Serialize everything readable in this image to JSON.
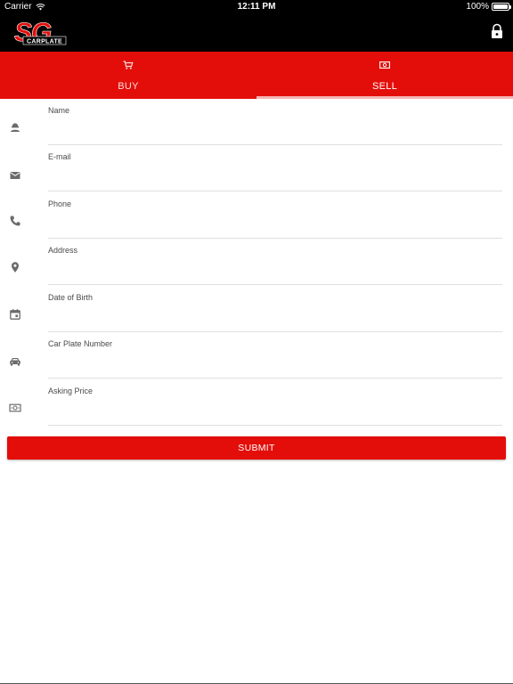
{
  "status_bar": {
    "carrier": "Carrier",
    "time": "12:11 PM",
    "battery": "100%",
    "icons": [
      "wifi-icon",
      "battery-icon"
    ]
  },
  "app_bar": {
    "logo_text_top": "SG",
    "logo_text_bottom": "CARPLATE",
    "icons": [
      "lock-icon"
    ]
  },
  "tabs": [
    {
      "label": "BUY",
      "icon": "cart-icon",
      "selected": false
    },
    {
      "label": "SELL",
      "icon": "money-icon",
      "selected": true
    }
  ],
  "form": {
    "fields": [
      {
        "label": "Name",
        "value": "",
        "icon": "person-icon"
      },
      {
        "label": "E-mail",
        "value": "",
        "icon": "envelope-icon"
      },
      {
        "label": "Phone",
        "value": "",
        "icon": "phone-icon"
      },
      {
        "label": "Address",
        "value": "",
        "icon": "location-pin-icon"
      },
      {
        "label": "Date of Birth",
        "value": "",
        "icon": "calendar-icon"
      },
      {
        "label": "Car Plate Number",
        "value": "",
        "icon": "car-icon"
      },
      {
        "label": "Asking Price",
        "value": "",
        "icon": "money-icon"
      }
    ],
    "submit_label": "SUBMIT"
  },
  "colors": {
    "primary_red": "#e30e0a",
    "app_bar": "#000000",
    "tab_indicator": "#f4b5b3",
    "icon_gray": "#6b6b6b"
  }
}
